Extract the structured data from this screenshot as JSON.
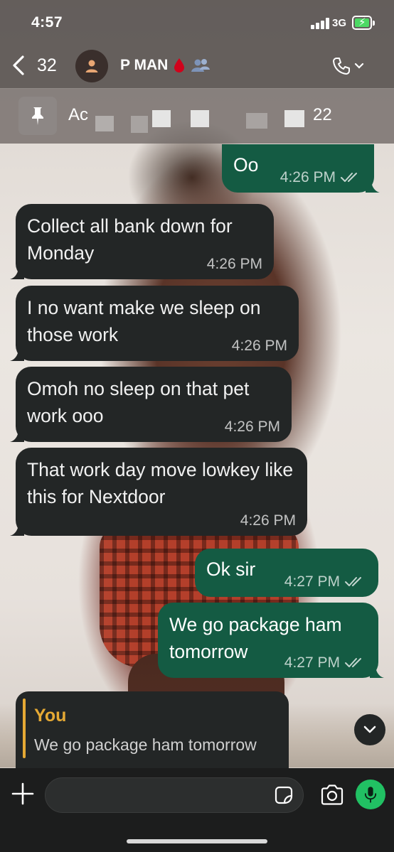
{
  "status_bar": {
    "time": "4:57",
    "network": "3G"
  },
  "header": {
    "back_count": "32",
    "contact_name": "P MAN",
    "icons": [
      "chevron-left-icon",
      "avatar-person-icon",
      "blood-drop-emoji",
      "people-emoji",
      "phone-icon",
      "chevron-down-icon"
    ]
  },
  "pinned": {
    "text_prefix": "Ac",
    "text_suffix": "22"
  },
  "messages": [
    {
      "dir": "out",
      "text": "Oo",
      "time": "4:26 PM",
      "read": true
    },
    {
      "dir": "in",
      "text": "Collect all bank down for Monday",
      "time": "4:26 PM"
    },
    {
      "dir": "in",
      "text": "I no want make we sleep on those work",
      "time": "4:26 PM"
    },
    {
      "dir": "in",
      "text": "Omoh no sleep on that pet work ooo",
      "time": "4:26 PM"
    },
    {
      "dir": "in",
      "text": "That work day move  lowkey like this for Nextdoor",
      "time": "4:26 PM"
    },
    {
      "dir": "out",
      "text": "Ok sir",
      "time": "4:27 PM",
      "read": true
    },
    {
      "dir": "out",
      "text": "We go package ham tomorrow",
      "time": "4:27 PM",
      "read": true
    }
  ],
  "reply": {
    "author": "You",
    "text": "We go package ham tomorrow"
  },
  "composer": {
    "placeholder": ""
  },
  "colors": {
    "incoming_bubble": "#232626",
    "outgoing_bubble": "#145b43",
    "accent": "#21c063",
    "reply_author": "#e5a934"
  }
}
